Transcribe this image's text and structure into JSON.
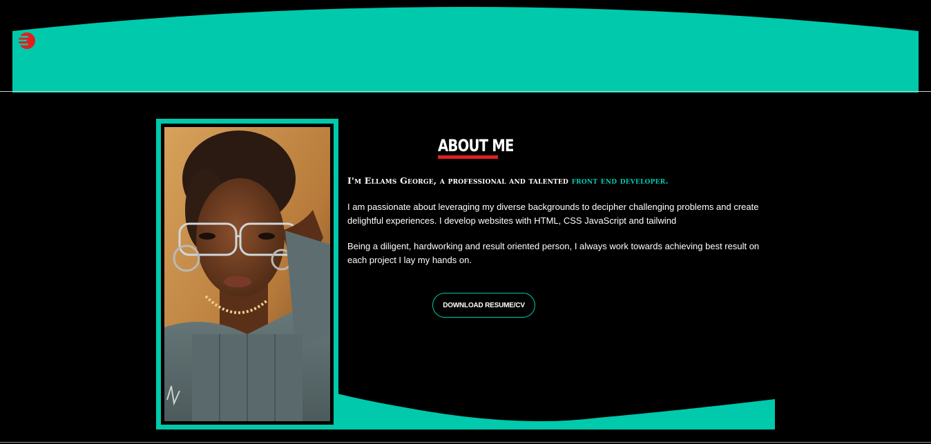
{
  "colors": {
    "accent": "#00c9ac",
    "brand_red": "#e02020",
    "background": "#000000",
    "text": "#ffffff"
  },
  "header": {
    "logo_icon": "stacked-wave-logo-icon"
  },
  "about": {
    "title": "ABOUT ME",
    "intro_prefix": "I'm Ellams George, a professional and talented",
    "intro_role": "front end developer.",
    "paragraph_1": "I am passionate about leveraging my diverse backgrounds to decipher challenging problems and create delightful experiences. I develop websites with HTML, CSS JavaScript and tailwind",
    "paragraph_2": "Being a diligent, hardworking and result oriented person, I always work towards achieving best result on each project I lay my hands on.",
    "download_label": "DOWNLOAD RESUME/CV"
  },
  "photo": {
    "subject_icon": "portrait-photo"
  }
}
